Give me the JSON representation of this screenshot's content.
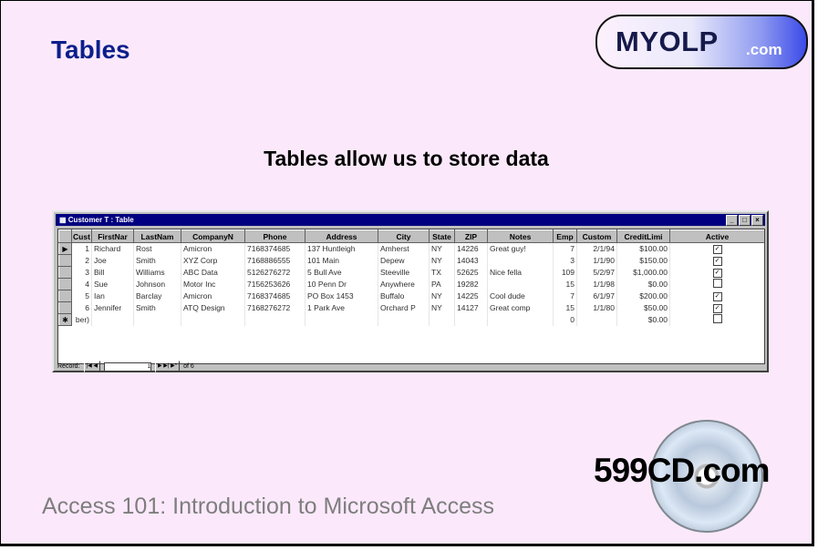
{
  "slide": {
    "title": "Tables",
    "logo_main": "MYOLP",
    "logo_suffix": ".com",
    "subtitle": "Tables allow us to store data",
    "footer": "Access 101: Introduction to Microsoft Access",
    "cd_logo": "599CD.com"
  },
  "window": {
    "title": "Customer T : Table",
    "buttons": [
      "_",
      "□",
      "×"
    ],
    "columns": [
      "Cust",
      "FirstNar",
      "LastNam",
      "CompanyN",
      "Phone",
      "Address",
      "City",
      "State",
      "ZIP",
      "Notes",
      "Emp",
      "Custom",
      "CreditLimi",
      "Active"
    ],
    "rows": [
      {
        "sel": "▶",
        "id": "1",
        "first": "Richard",
        "last": "Rost",
        "company": "Amicron",
        "phone": "7168374685",
        "address": "137 Huntleigh",
        "city": "Amherst",
        "state": "NY",
        "zip": "14226",
        "notes": "Great guy!",
        "emp": "7",
        "since": "2/1/94",
        "credit": "$100.00",
        "active": "✓"
      },
      {
        "sel": "",
        "id": "2",
        "first": "Joe",
        "last": "Smith",
        "company": "XYZ Corp",
        "phone": "7168886555",
        "address": "101 Main",
        "city": "Depew",
        "state": "NY",
        "zip": "14043",
        "notes": "",
        "emp": "3",
        "since": "1/1/90",
        "credit": "$150.00",
        "active": "✓"
      },
      {
        "sel": "",
        "id": "3",
        "first": "Bill",
        "last": "Williams",
        "company": "ABC Data",
        "phone": "5126276272",
        "address": "5 Bull Ave",
        "city": "Steeville",
        "state": "TX",
        "zip": "52625",
        "notes": "Nice fella",
        "emp": "109",
        "since": "5/2/97",
        "credit": "$1,000.00",
        "active": "✓"
      },
      {
        "sel": "",
        "id": "4",
        "first": "Sue",
        "last": "Johnson",
        "company": "Motor Inc",
        "phone": "7156253626",
        "address": "10 Penn Dr",
        "city": "Anywhere",
        "state": "PA",
        "zip": "19282",
        "notes": "",
        "emp": "15",
        "since": "1/1/98",
        "credit": "$0.00",
        "active": ""
      },
      {
        "sel": "",
        "id": "5",
        "first": "Ian",
        "last": "Barclay",
        "company": "Amicron",
        "phone": "7168374685",
        "address": "PO Box 1453",
        "city": "Buffalo",
        "state": "NY",
        "zip": "14225",
        "notes": "Cool dude",
        "emp": "7",
        "since": "6/1/97",
        "credit": "$200.00",
        "active": "✓"
      },
      {
        "sel": "",
        "id": "6",
        "first": "Jennifer",
        "last": "Smith",
        "company": "ATQ Design",
        "phone": "7168276272",
        "address": "1 Park Ave",
        "city": "Orchard P",
        "state": "NY",
        "zip": "14127",
        "notes": "Great comp",
        "emp": "15",
        "since": "1/1/80",
        "credit": "$50.00",
        "active": "✓"
      },
      {
        "sel": "✱",
        "id": "ber)",
        "first": "",
        "last": "",
        "company": "",
        "phone": "",
        "address": "",
        "city": "",
        "state": "",
        "zip": "",
        "notes": "",
        "emp": "0",
        "since": "",
        "credit": "$0.00",
        "active": ""
      }
    ],
    "status": {
      "record_label": "Record:",
      "nav_left": "|◀ ◀",
      "current": "1",
      "nav_right": "▶ ▶| ▶*",
      "of_label": "of 6"
    }
  }
}
